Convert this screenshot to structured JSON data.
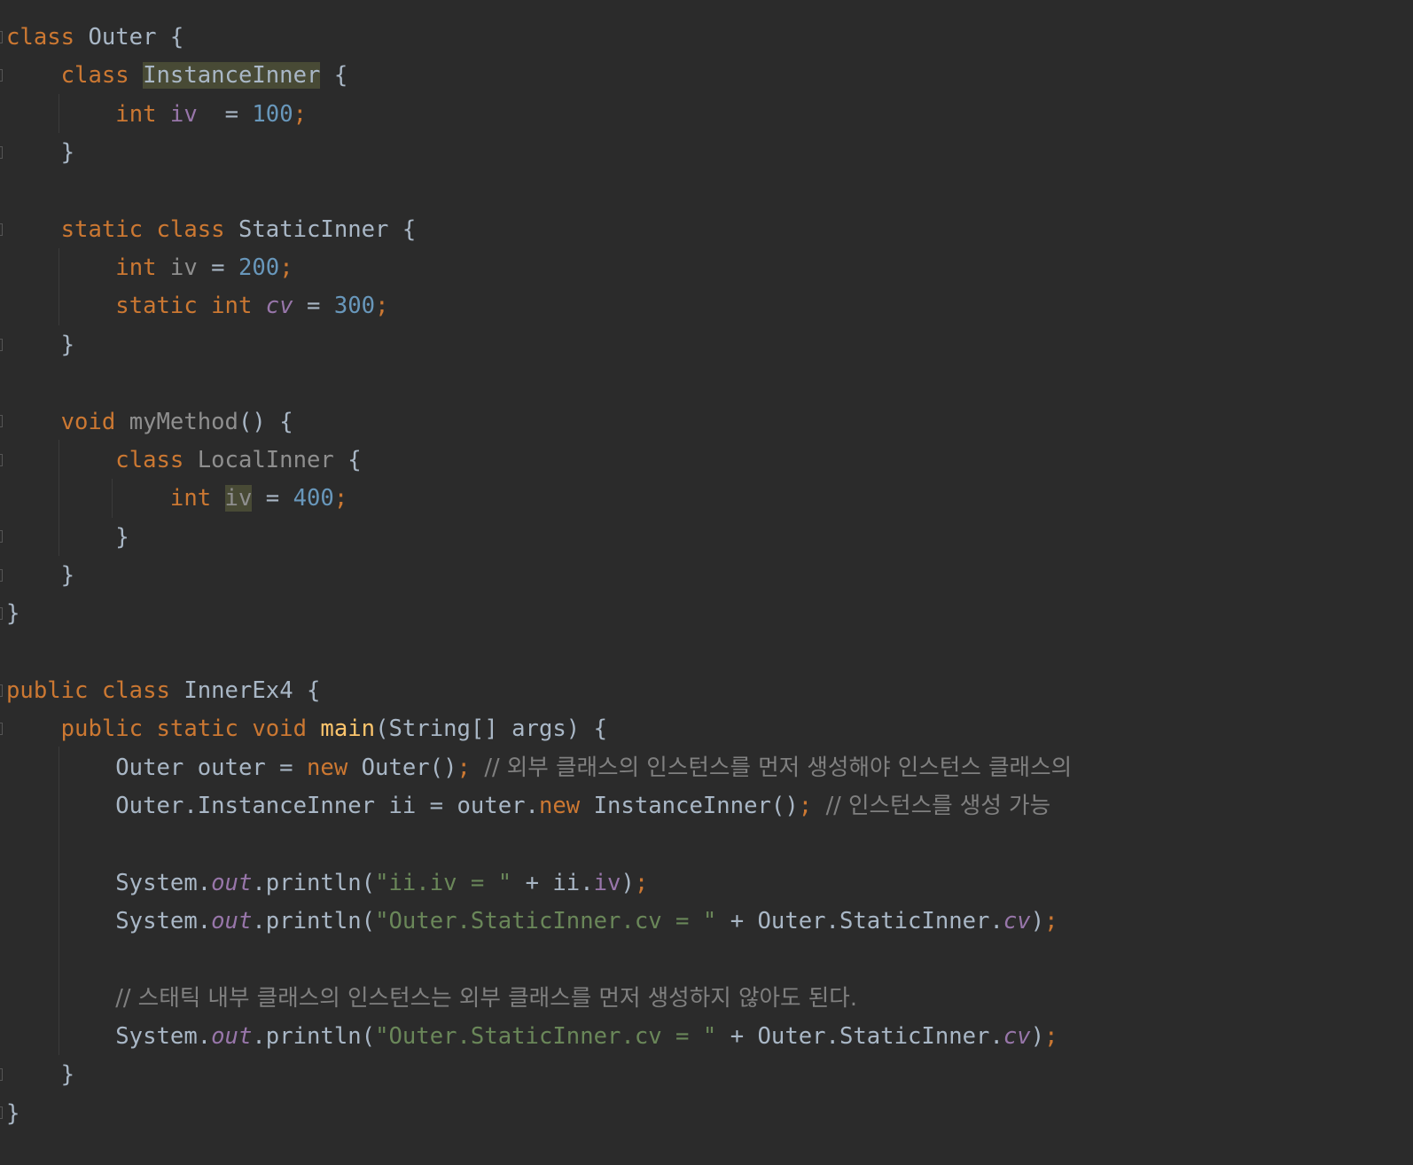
{
  "editor": {
    "language": "Java",
    "lines": [
      [
        {
          "c": "kw",
          "t": "class "
        },
        {
          "c": "",
          "t": "Outer {"
        }
      ],
      [
        {
          "c": "",
          "t": "    "
        },
        {
          "c": "kw",
          "t": "class "
        },
        {
          "c": "hl",
          "t": "InstanceInner"
        },
        {
          "c": "",
          "t": " {"
        }
      ],
      [
        {
          "c": "",
          "t": "        "
        },
        {
          "c": "kw",
          "t": "int "
        },
        {
          "c": "fld",
          "t": "iv"
        },
        {
          "c": "",
          "t": "  = "
        },
        {
          "c": "num",
          "t": "100"
        },
        {
          "c": "semi",
          "t": ";"
        }
      ],
      [
        {
          "c": "",
          "t": "    }"
        }
      ],
      [],
      [
        {
          "c": "",
          "t": "    "
        },
        {
          "c": "kw",
          "t": "static class "
        },
        {
          "c": "",
          "t": "StaticInner {"
        }
      ],
      [
        {
          "c": "",
          "t": "        "
        },
        {
          "c": "kw",
          "t": "int "
        },
        {
          "c": "unused",
          "t": "iv"
        },
        {
          "c": "",
          "t": " = "
        },
        {
          "c": "num",
          "t": "200"
        },
        {
          "c": "semi",
          "t": ";"
        }
      ],
      [
        {
          "c": "",
          "t": "        "
        },
        {
          "c": "kw",
          "t": "static int "
        },
        {
          "c": "sfld",
          "t": "cv"
        },
        {
          "c": "",
          "t": " = "
        },
        {
          "c": "num",
          "t": "300"
        },
        {
          "c": "semi",
          "t": ";"
        }
      ],
      [
        {
          "c": "",
          "t": "    }"
        }
      ],
      [],
      [
        {
          "c": "",
          "t": "    "
        },
        {
          "c": "kw",
          "t": "void "
        },
        {
          "c": "unused",
          "t": "myMethod"
        },
        {
          "c": "",
          "t": "() {"
        }
      ],
      [
        {
          "c": "",
          "t": "        "
        },
        {
          "c": "kw",
          "t": "class "
        },
        {
          "c": "unused",
          "t": "LocalInner"
        },
        {
          "c": "",
          "t": " {"
        }
      ],
      [
        {
          "c": "",
          "t": "            "
        },
        {
          "c": "kw",
          "t": "int "
        },
        {
          "c": "hl unused",
          "t": "iv"
        },
        {
          "c": "",
          "t": " = "
        },
        {
          "c": "num",
          "t": "400"
        },
        {
          "c": "semi",
          "t": ";"
        }
      ],
      [
        {
          "c": "",
          "t": "        }"
        }
      ],
      [
        {
          "c": "",
          "t": "    }"
        }
      ],
      [
        {
          "c": "",
          "t": "}"
        }
      ],
      [],
      [
        {
          "c": "kw",
          "t": "public class "
        },
        {
          "c": "",
          "t": "InnerEx4 {"
        }
      ],
      [
        {
          "c": "",
          "t": "    "
        },
        {
          "c": "kw",
          "t": "public static void "
        },
        {
          "c": "fn",
          "t": "main"
        },
        {
          "c": "",
          "t": "(String[] args) {"
        }
      ],
      [
        {
          "c": "",
          "t": "        Outer outer = "
        },
        {
          "c": "kw",
          "t": "new "
        },
        {
          "c": "",
          "t": "Outer()"
        },
        {
          "c": "semi",
          "t": "; "
        },
        {
          "c": "cmt ko",
          "t": "// 외부 클래스의 인스턴스를 먼저 생성해야 인스턴스 클래스의"
        }
      ],
      [
        {
          "c": "",
          "t": "        Outer.InstanceInner ii = outer."
        },
        {
          "c": "kw",
          "t": "new "
        },
        {
          "c": "",
          "t": "InstanceInner()"
        },
        {
          "c": "semi",
          "t": "; "
        },
        {
          "c": "cmt ko",
          "t": "// 인스턴스를 생성 가능"
        }
      ],
      [],
      [
        {
          "c": "",
          "t": "        System."
        },
        {
          "c": "sfld",
          "t": "out"
        },
        {
          "c": "",
          "t": ".println("
        },
        {
          "c": "str",
          "t": "\"ii.iv = \""
        },
        {
          "c": "",
          "t": " + ii."
        },
        {
          "c": "fld",
          "t": "iv"
        },
        {
          "c": "",
          "t": ")"
        },
        {
          "c": "semi",
          "t": ";"
        }
      ],
      [
        {
          "c": "",
          "t": "        System."
        },
        {
          "c": "sfld",
          "t": "out"
        },
        {
          "c": "",
          "t": ".println("
        },
        {
          "c": "str",
          "t": "\"Outer.StaticInner.cv = \""
        },
        {
          "c": "",
          "t": " + Outer.StaticInner."
        },
        {
          "c": "sfld",
          "t": "cv"
        },
        {
          "c": "",
          "t": ")"
        },
        {
          "c": "semi",
          "t": ";"
        }
      ],
      [],
      [
        {
          "c": "cmt",
          "t": "        "
        },
        {
          "c": "cmt ko",
          "t": "// 스태틱 내부 클래스의 인스턴스는 외부 클래스를 먼저 생성하지 않아도 된다."
        }
      ],
      [
        {
          "c": "",
          "t": "        System."
        },
        {
          "c": "sfld",
          "t": "out"
        },
        {
          "c": "",
          "t": ".println("
        },
        {
          "c": "str",
          "t": "\"Outer.StaticInner.cv = \""
        },
        {
          "c": "",
          "t": " + Outer.StaticInner."
        },
        {
          "c": "sfld",
          "t": "cv"
        },
        {
          "c": "",
          "t": ")"
        },
        {
          "c": "semi",
          "t": ";"
        }
      ],
      [
        {
          "c": "",
          "t": "    }"
        }
      ],
      [
        {
          "c": "",
          "t": "}"
        }
      ]
    ]
  },
  "colors": {
    "background": "#2b2b2b",
    "text": "#a9b7c6",
    "keyword": "#cc7832",
    "number": "#6897bb",
    "field": "#9876aa",
    "string": "#6a8759",
    "comment": "#808080",
    "method": "#ffc66d",
    "highlight": "#484a35"
  }
}
